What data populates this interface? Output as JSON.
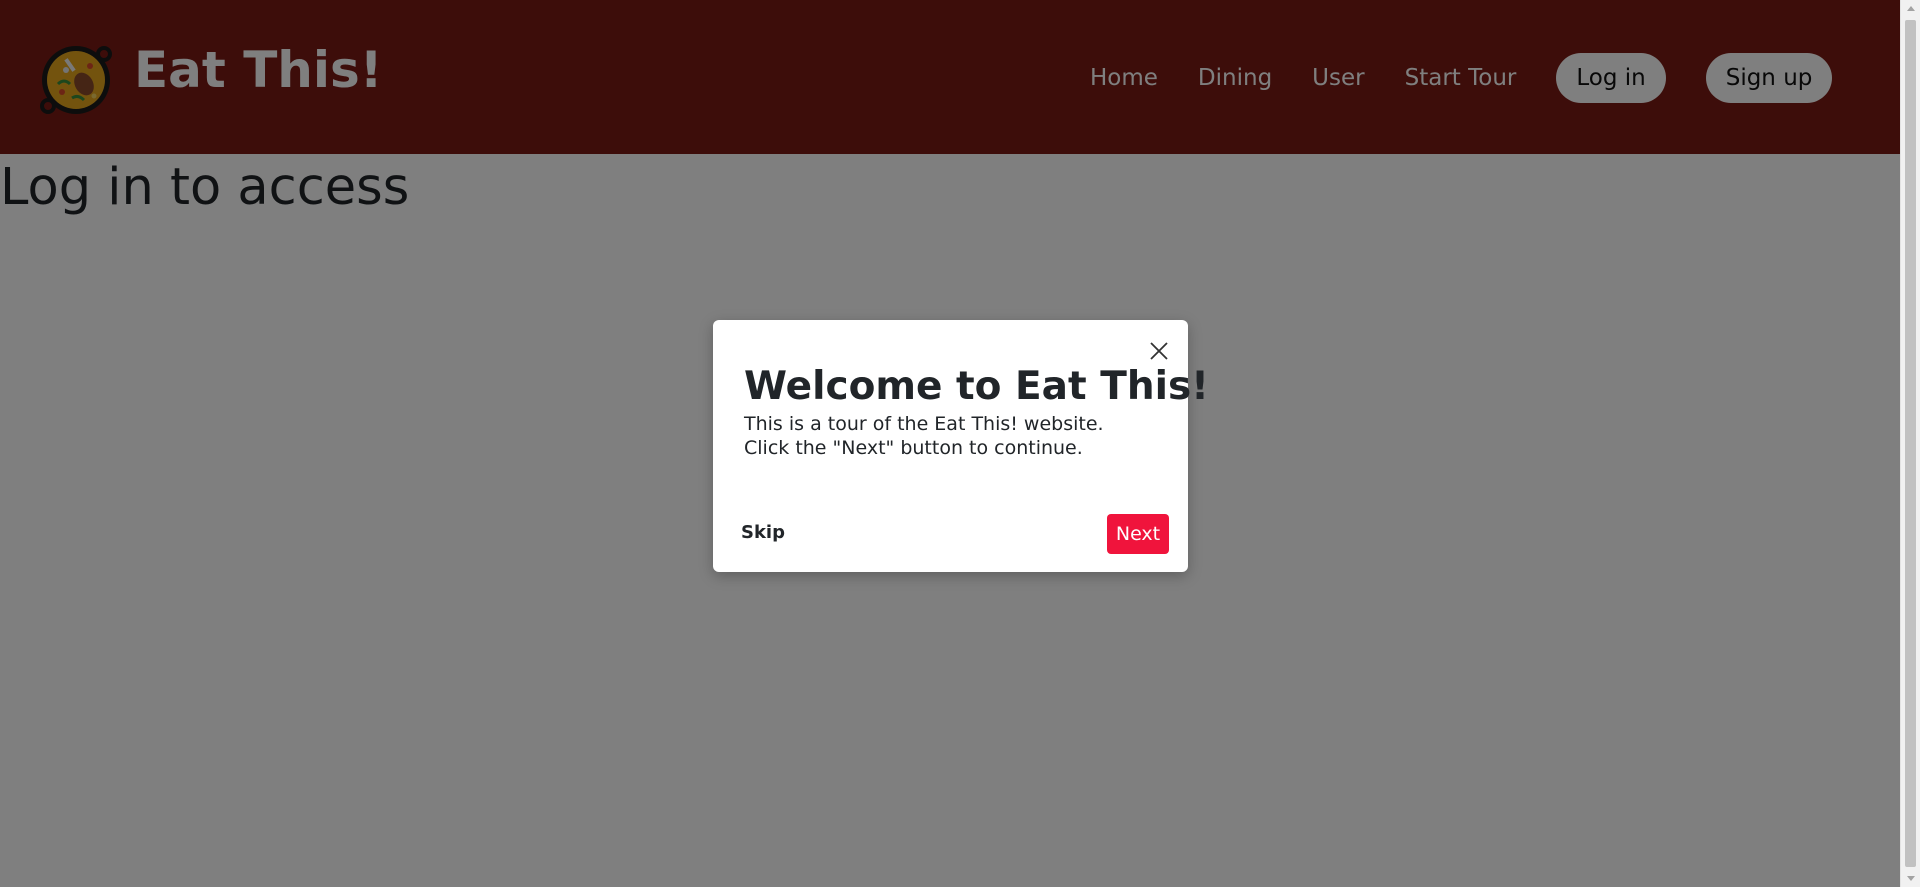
{
  "header": {
    "brand": "Eat This!",
    "logo_icon": "paella-pan-icon",
    "nav": {
      "home": "Home",
      "dining": "Dining",
      "user": "User",
      "start_tour": "Start Tour",
      "login": "Log in",
      "signup": "Sign up"
    }
  },
  "main": {
    "heading": "Log in to access"
  },
  "tour_modal": {
    "title": "Welcome to Eat This!",
    "text": "This is a tour of the Eat This! website. Click the \"Next\" button to continue.",
    "skip_label": "Skip",
    "next_label": "Next",
    "close_icon": "close-icon"
  },
  "colors": {
    "header_bg": "#7a1a14",
    "next_button": "#f0143c",
    "overlay": "rgba(0,0,0,0.5)"
  }
}
